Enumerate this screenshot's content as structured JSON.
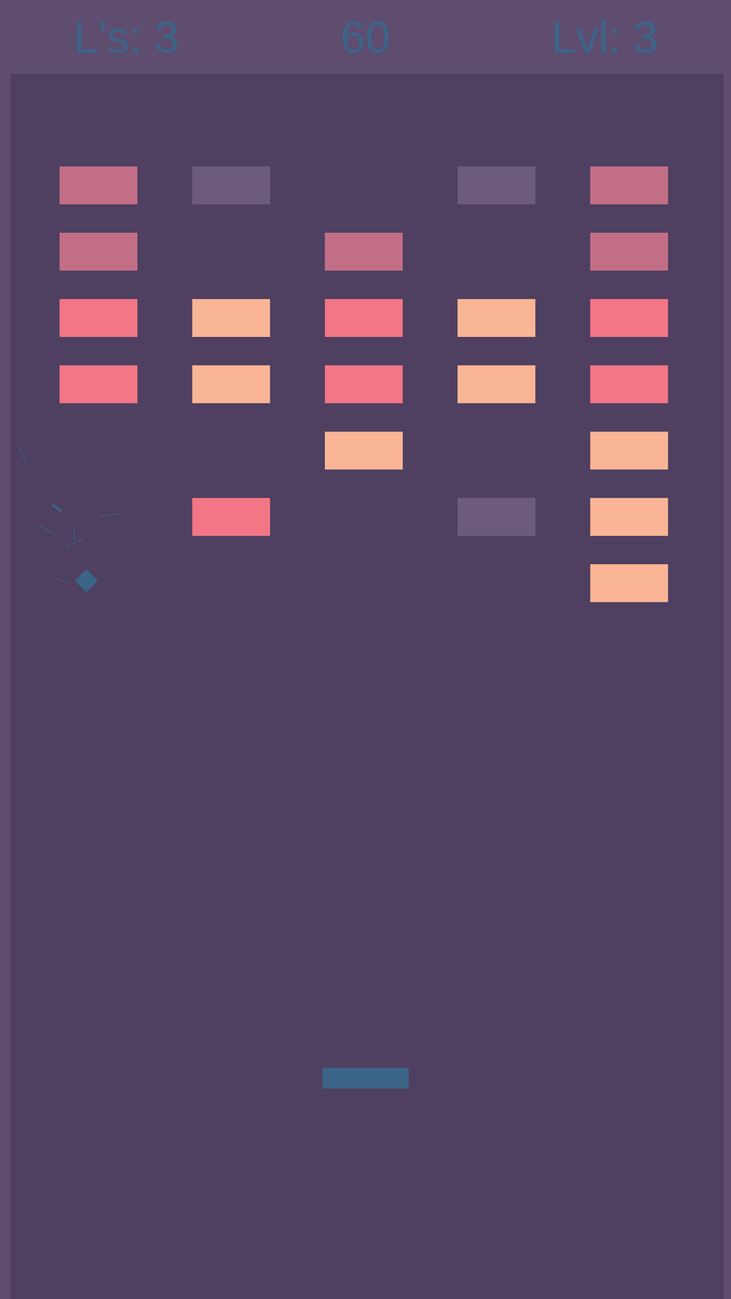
{
  "hud": {
    "lives": "L's: 3",
    "score": "60",
    "level": "Lvl: 3"
  },
  "bricks": [
    [
      {
        "kind": "brick",
        "color": "#c36e87"
      },
      {
        "kind": "brick",
        "color": "#6d5b7b"
      },
      {
        "kind": "empty"
      },
      {
        "kind": "brick",
        "color": "#6d5b7b"
      },
      {
        "kind": "brick",
        "color": "#c36e87"
      }
    ],
    [
      {
        "kind": "brick",
        "color": "#c36e87"
      },
      {
        "kind": "empty"
      },
      {
        "kind": "brick",
        "color": "#c36e87"
      },
      {
        "kind": "empty"
      },
      {
        "kind": "brick",
        "color": "#c36e87"
      }
    ],
    [
      {
        "kind": "brick",
        "color": "#f27685"
      },
      {
        "kind": "brick",
        "color": "#f9b595"
      },
      {
        "kind": "brick",
        "color": "#f27685"
      },
      {
        "kind": "brick",
        "color": "#f9b595"
      },
      {
        "kind": "brick",
        "color": "#f27685"
      }
    ],
    [
      {
        "kind": "brick",
        "color": "#f27685"
      },
      {
        "kind": "brick",
        "color": "#f9b595"
      },
      {
        "kind": "brick",
        "color": "#f27685"
      },
      {
        "kind": "brick",
        "color": "#f9b595"
      },
      {
        "kind": "brick",
        "color": "#f27685"
      }
    ],
    [
      {
        "kind": "empty"
      },
      {
        "kind": "empty"
      },
      {
        "kind": "brick",
        "color": "#f9b595"
      },
      {
        "kind": "empty"
      },
      {
        "kind": "brick",
        "color": "#f9b595"
      }
    ],
    [
      {
        "kind": "empty"
      },
      {
        "kind": "brick",
        "color": "#f27685"
      },
      {
        "kind": "empty"
      },
      {
        "kind": "brick",
        "color": "#6d5b7b"
      },
      {
        "kind": "brick",
        "color": "#f9b595"
      }
    ],
    [
      {
        "kind": "empty"
      },
      {
        "kind": "empty"
      },
      {
        "kind": "empty"
      },
      {
        "kind": "empty"
      },
      {
        "kind": "brick",
        "color": "#f9b595"
      }
    ]
  ]
}
